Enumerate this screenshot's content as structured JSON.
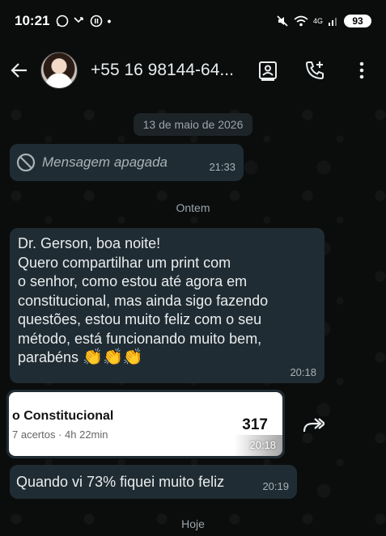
{
  "status_bar": {
    "time": "10:21",
    "network": "4G",
    "battery": "93"
  },
  "header": {
    "contact": "+55 16 98144-64..."
  },
  "dates": {
    "first": "13 de maio de 2026",
    "second": "Ontem",
    "third": "Hoje"
  },
  "messages": {
    "deleted": {
      "text": "Mensagem apagada",
      "time": "21:33"
    },
    "long": {
      "lines": [
        "Dr. Gerson, boa noite!",
        "Quero compartilhar um print com",
        "o senhor, como estou até agora em",
        "constitucional, mas ainda sigo fazendo",
        "questões, estou muito feliz com o seu",
        "método, está funcionando muito bem,",
        "parabéns"
      ],
      "emoji": "👏👏👏",
      "time": "20:18"
    },
    "image": {
      "title": "o Constitucional",
      "subtitle": "7 acertos · 4h 22min",
      "number": "317",
      "time": "20:18"
    },
    "short": {
      "text": "Quando vi 73% fiquei muito feliz",
      "time": "20:19"
    }
  },
  "colors": {
    "background": "#0b0d0d",
    "bubble": "#202c33",
    "text": "#e9edef",
    "meta": "#a8b2b7"
  }
}
